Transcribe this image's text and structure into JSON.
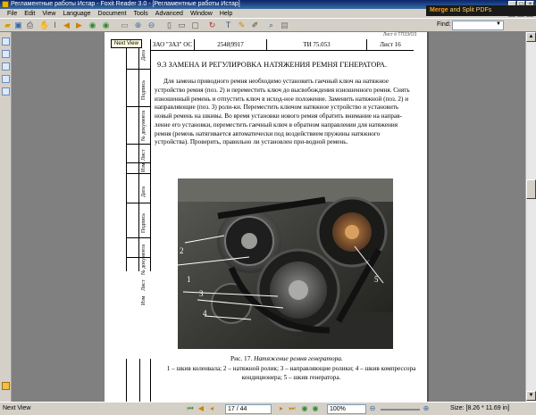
{
  "window": {
    "title": "Регламентные работы Истар - Foxit Reader 3.0 - [Регламентные работы Истар]"
  },
  "menu": {
    "items": [
      "File",
      "Edit",
      "View",
      "Language",
      "Document",
      "Tools",
      "Advanced",
      "Window",
      "Help"
    ]
  },
  "toolbar": {
    "find_label": "Find:",
    "find_value": "",
    "banner_part1": "Merge",
    "banner_part2": "and Split PDFs"
  },
  "tooltip": "Next View",
  "page": {
    "header": {
      "company": "ЗАО \"ЗАЗ\" ОС",
      "code": "2548|9917",
      "ti": "ТИ 75.053",
      "sheet": "Лист 16",
      "doc_no": "Лист ё ТПЗЗ/ОЗ"
    },
    "stamp": {
      "labels": [
        "Дата",
        "Подпись",
        "№ документа",
        "Лист",
        "Изм",
        "Дата",
        "Подпись",
        "№ документа",
        "Лист",
        "Изм"
      ]
    },
    "title": "9.3 ЗАМЕНА И РЕГУЛИРОВКА НАТЯЖЕНИЯ РЕМНЯ ГЕНЕРАТОРА.",
    "body": [
      "Для замены приводного ремня  необходимо установить гаечный ключ на натяжное устройство ремня (поз. 2) и переместить ключ до высвобождения изношенного ремня. Снять изношенный ремень и отпустить ключ в исход-ное положение. Заменить натяжной (поз. 2) и направляющие (поз. 3) роли-ки. Переместить ключом натяжное устройство и установить новый ремень на шкивы. Во время установки нового ремня обратить внимание на направ-ление его установки, переместить гаечный ключ в обратном направлении для натяжения ремня (ремень натягивается автоматически под воздействием пружины натяжного устройства). Проверить, правильно ли установлен при-водной ремень."
    ],
    "photo_labels": [
      "2",
      "1",
      "3",
      "4",
      "5"
    ],
    "caption_prefix": "Рис. 17. ",
    "caption_title": "Натяжение ремня генератора.",
    "caption_text": "1 – шкив коленвала; 2 – натяжной ролик; 3 – направляющие ролики; 4 – шкив компрессора кондиционера; 5 – шкив генератора."
  },
  "status": {
    "left": "Next View",
    "page_box": "17 / 44",
    "zoom": "100%",
    "size": "Size: [8.26 * 11.69 in]"
  }
}
